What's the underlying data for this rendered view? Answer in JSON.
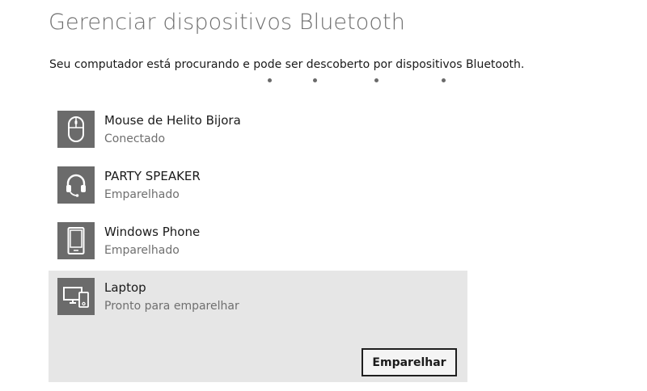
{
  "header": {
    "title": "Gerenciar dispositivos Bluetooth",
    "subtitle": "Seu computador está procurando e pode ser descoberto por dispositivos Bluetooth."
  },
  "progress": {
    "dot_count": 4
  },
  "devices": [
    {
      "name": "Mouse de Helito Bijora",
      "status": "Conectado",
      "icon": "mouse-icon"
    },
    {
      "name": "PARTY SPEAKER",
      "status": "Emparelhado",
      "icon": "headset-icon"
    },
    {
      "name": "Windows Phone",
      "status": "Emparelhado",
      "icon": "phone-icon"
    },
    {
      "name": "Laptop",
      "status": "Pronto para emparelhar",
      "icon": "laptop-phone-icon",
      "selected": true,
      "action_label": "Emparelhar"
    }
  ],
  "colors": {
    "tile": "#6b6b6b",
    "selected_bg": "#e6e6e6",
    "title": "#6f6f6f",
    "status": "#6f6f6f"
  }
}
